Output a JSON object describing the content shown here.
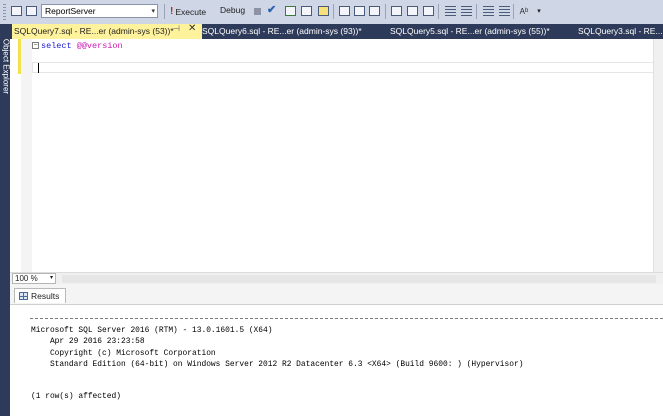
{
  "toolbar": {
    "database": "ReportServer",
    "execute_label": "Execute",
    "debug_label": "Debug",
    "execute_icon": "exclamation-icon",
    "stop_icon": "stop-icon",
    "parse_icon": "checkmark-icon",
    "dropdown_glyph": "▾"
  },
  "left_panel": {
    "label": "Object Explorer"
  },
  "tabs": [
    {
      "label": "SQLQuery7.sql - RE...er (admin-sys (53))*",
      "active": true
    },
    {
      "label": "SQLQuery6.sql - RE...er (admin-sys (93))*",
      "active": false
    },
    {
      "label": "SQLQuery5.sql - RE...er (admin-sys (55))*",
      "active": false
    },
    {
      "label": "SQLQuery3.sql - RE...",
      "active": false
    }
  ],
  "tab_pin_glyph": "⊣",
  "tab_close_glyph": "✕",
  "editor": {
    "collapse_glyph": "−",
    "keyword": "select",
    "variable": "@@version"
  },
  "zoom": {
    "value": "100 %"
  },
  "results": {
    "tab_label": "Results",
    "lines": [
      "Microsoft SQL Server 2016 (RTM) - 13.0.1601.5 (X64)",
      "    Apr 29 2016 23:23:58",
      "    Copyright (c) Microsoft Corporation",
      "    Standard Edition (64-bit) on Windows Server 2012 R2 Datacenter 6.3 <X64> (Build 9600: ) (Hypervisor)"
    ],
    "affected": "(1 row(s) affected)"
  },
  "colors": {
    "active_tab": "#fff29d",
    "tab_strip": "#2d3a59",
    "keyword": "#1b1bd6",
    "variable": "#d016b5",
    "toolbar_bg": "#cfd6e5"
  }
}
